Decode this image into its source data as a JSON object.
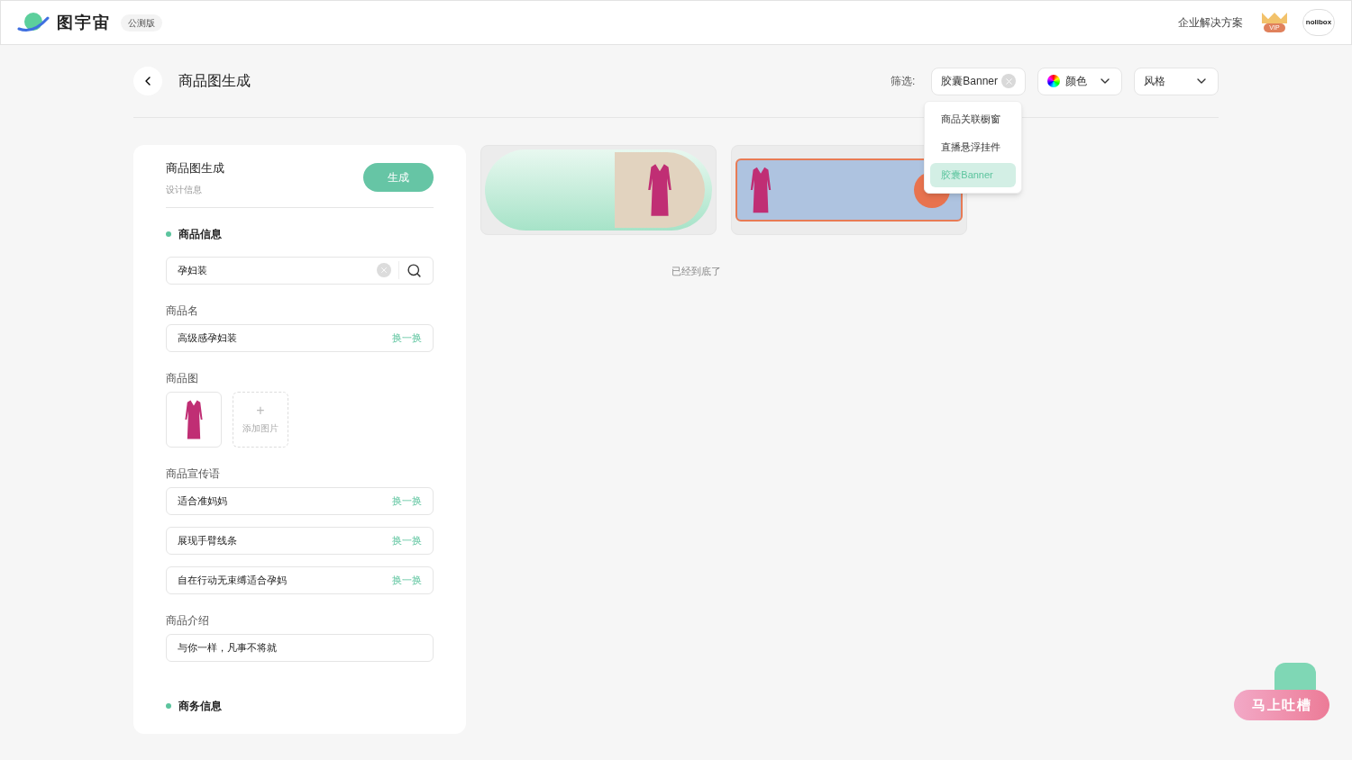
{
  "header": {
    "logo_text": "图宇宙",
    "badge": "公测版",
    "nav_link": "企业解决方案",
    "vip_label": "VIP",
    "avatar_text": "nolibox"
  },
  "page": {
    "title": "商品图生成",
    "filter_label": "筛选:",
    "filters": [
      {
        "kind": "chip",
        "label": "胶囊Banner"
      },
      {
        "kind": "color",
        "label": "颜色"
      },
      {
        "kind": "select",
        "label": "风格"
      }
    ],
    "dropdown": [
      {
        "label": "商品关联橱窗",
        "selected": false
      },
      {
        "label": "直播悬浮挂件",
        "selected": false
      },
      {
        "label": "胶囊Banner",
        "selected": true
      }
    ]
  },
  "form": {
    "title": "商品图生成",
    "subtitle": "设计信息",
    "generate_button": "生成",
    "section_1": "商品信息",
    "search_value": "孕妇装",
    "name_label": "商品名",
    "name_value": "高级感孕妇装",
    "swap": "换一换",
    "image_label": "商品图",
    "add_image": "添加图片",
    "add_icon": "+",
    "slogan_label": "商品宣传语",
    "slogans": [
      {
        "value": "适合准妈妈",
        "action": "换一换"
      },
      {
        "value": "展现手臂线条",
        "action": "换一换"
      },
      {
        "value": "自在行动无束缚适合孕妈",
        "action": "换一换"
      }
    ],
    "intro_label": "商品介绍",
    "intro_value": "与你一样，凡事不将就",
    "section_2": "商务信息"
  },
  "results": {
    "banners": [
      {
        "kind": "capsule"
      },
      {
        "kind": "festival"
      }
    ],
    "end_text": "已经到底了"
  },
  "feedback": {
    "label": "马上吐槽"
  }
}
